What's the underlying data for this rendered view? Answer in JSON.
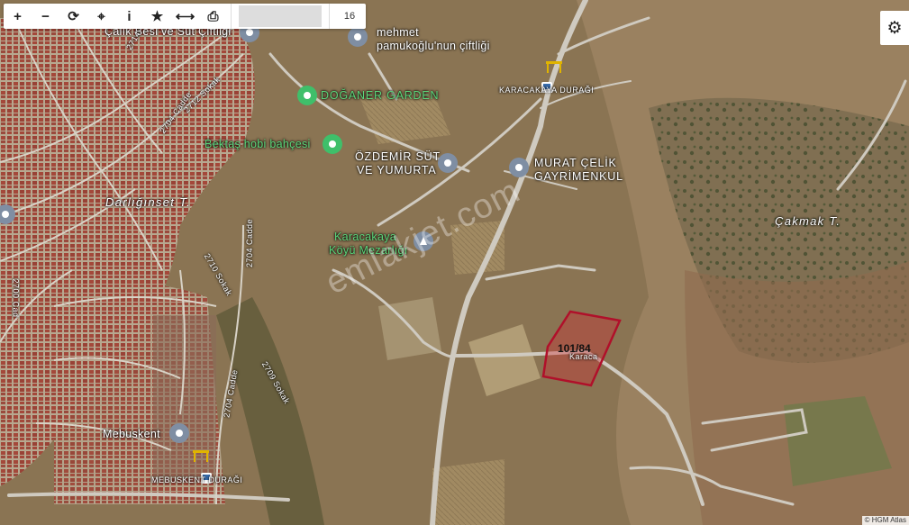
{
  "toolbar": {
    "buttons": [
      "+",
      "−",
      "⟳",
      "⌖",
      "i",
      "★",
      "⟷",
      "⎙"
    ],
    "zoom_value": "16"
  },
  "settings_icon": "⚙",
  "places": {
    "catik": "Çalık Besi ve Süt Çiftliği",
    "mehmet_1": "mehmet",
    "mehmet_2": "pamukoğlu'nun çiftliği",
    "doganer": "DOĞANER GARDEN",
    "bektas": "Bektaş hobi bahçesi",
    "ozdemir_1": "ÖZDEMİR SÜT",
    "ozdemir_2": "VE YUMURTA",
    "murat_1": "MURAT ÇELİK",
    "murat_2": "GAYRİMENKUL",
    "karacakaya_1": "Karacakaya",
    "karacakaya_2": "Köyü Mezarlığı",
    "durak_top": "KARACAKAYA DURAĞI",
    "durak_bottom": "MEBUSKENT DURAĞI",
    "mebuskent": "Mebuskent",
    "darliginset": "Darlığınset T.",
    "cakmak": "Çakmak T."
  },
  "streets": {
    "s2704a": "2704 Cadde",
    "s2712": "2712 Sokak",
    "s2714": "2714",
    "s2704b": "2704 Cadde",
    "s2710": "2710 Sokak",
    "s2709": "2709 Sokak",
    "s2704c": "2704 Cadde",
    "s2700": "2700 Cad",
    "karaca": "Karaca"
  },
  "parcel": {
    "label": "101/84",
    "stroke": "#b0102a",
    "fill": "rgba(210,40,50,0.35)"
  },
  "watermark": "emlakjet.com",
  "attribution": "© HGM Atlas",
  "colors": {
    "terrain": "#8a7453",
    "road": "#c8c4bc",
    "pin": "#7f8ea3",
    "green_poi": "#3fbf6a",
    "bus_stop": "#e0b400"
  }
}
